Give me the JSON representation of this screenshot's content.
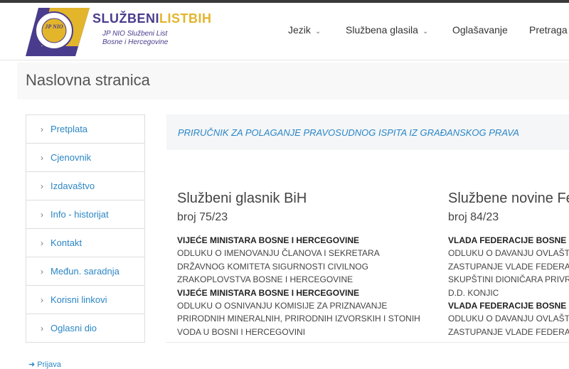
{
  "brand": {
    "title_part1": "SLUŽBENI",
    "title_part2": "LIST",
    "title_part3": "BIH",
    "sub_line1": "JP NIO Službeni List",
    "sub_line2": "Bosne i Hercegovine",
    "logo_text": "JP NIO",
    "colors": {
      "primary": "#4a3c8c",
      "accent": "#e3b52b"
    }
  },
  "nav": {
    "items": [
      {
        "label": "Jezik",
        "dropdown": true
      },
      {
        "label": "Službena glasila",
        "dropdown": true
      },
      {
        "label": "Oglašavanje",
        "dropdown": false
      },
      {
        "label": "Pretraga",
        "dropdown": false
      }
    ]
  },
  "page": {
    "title": "Naslovna stranica"
  },
  "sidebar": {
    "items": [
      {
        "label": "Pretplata"
      },
      {
        "label": "Cjenovnik"
      },
      {
        "label": "Izdavaštvo"
      },
      {
        "label": "Info - historijat"
      },
      {
        "label": "Kontakt"
      },
      {
        "label": "Međun. saradnja"
      },
      {
        "label": "Korisni linkovi"
      },
      {
        "label": "Oglasni dio"
      }
    ],
    "below_link": "Prijava"
  },
  "banner": {
    "text": "PRIRUČNIK ZA POLAGANJE PRAVOSUDNOG ISPITA IZ GRAĐANSKOG PRAVA"
  },
  "columns": [
    {
      "title": "Službeni glasnik BiH",
      "issue": "broj 75/23",
      "lines": [
        {
          "bold": true,
          "text": "VIJEĆE MINISTARA BOSNE I HERCEGOVINE"
        },
        {
          "bold": false,
          "text": "ODLUKU O IMENOVANJU ČLANOVA I SEKRETARA"
        },
        {
          "bold": false,
          "text": "DRŽAVNOG KOMITETA SIGURNOSTI CIVILNOG"
        },
        {
          "bold": false,
          "text": "ZRAKOPLOVSTVA BOSNE I HERCEGOVINE"
        },
        {
          "bold": true,
          "text": "VIJEĆE MINISTARA BOSNE I HERCEGOVINE"
        },
        {
          "bold": false,
          "text": "ODLUKU O OSNIVANJU KOMISIJE ZA PRIZNAVANJE"
        },
        {
          "bold": false,
          "text": "PRIRODNIH MINERALNIH, PRIRODNIH IZVORSKIH I STONIH"
        },
        {
          "bold": false,
          "text": "VODA U BOSNI I HERCEGOVINI"
        }
      ]
    },
    {
      "title": "Službene novine Fe",
      "issue": "broj 84/23",
      "lines": [
        {
          "bold": true,
          "text": "VLADA FEDERACIJE BOSNE"
        },
        {
          "bold": false,
          "text": "ODLUKU O DAVANJU OVLAŠT"
        },
        {
          "bold": false,
          "text": "ZASTUPANJE VLADE FEDERAC"
        },
        {
          "bold": false,
          "text": "SKUPŠTINI DIONIČARA PRIVR"
        },
        {
          "bold": false,
          "text": "D.D. KONJIC"
        },
        {
          "bold": true,
          "text": "VLADA FEDERACIJE BOSNE"
        },
        {
          "bold": false,
          "text": "ODLUKU O DAVANJU OVLAŠT"
        },
        {
          "bold": false,
          "text": "ZASTUPANJE VLADE FEDERAC"
        }
      ]
    }
  ]
}
